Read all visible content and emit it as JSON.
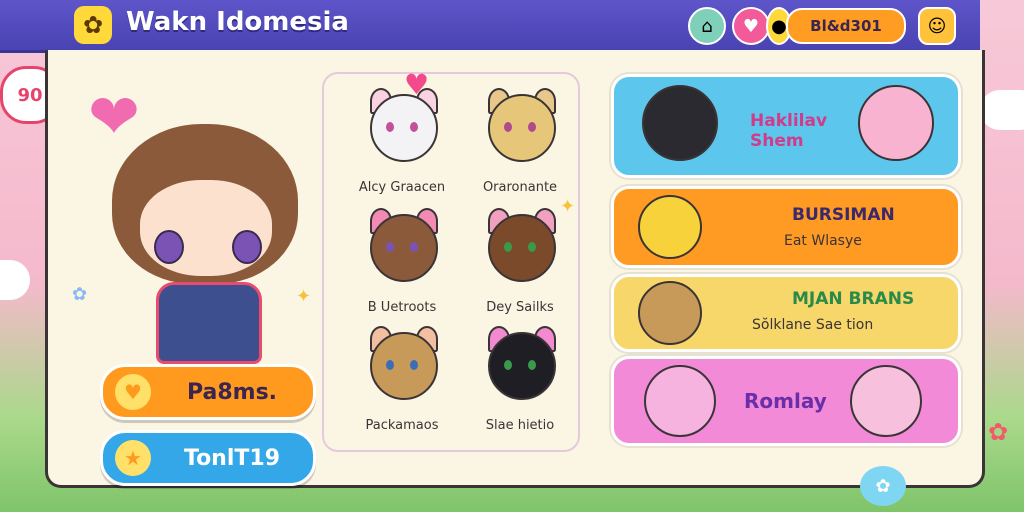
{
  "header": {
    "title": "Wakn Idomesia",
    "currency_value": "Bl&d301"
  },
  "left": {
    "badge_text": "90",
    "buttons": [
      {
        "label": "Pa8ms.",
        "color": "#ff9a1f",
        "icon": "heart-icon"
      },
      {
        "label": "TonlT19",
        "color": "#33a7e8",
        "icon": "star-icon"
      }
    ]
  },
  "characters": [
    {
      "name": "Alcy Graacen"
    },
    {
      "name": "Oraronante"
    },
    {
      "name": "B Uetroots"
    },
    {
      "name": "Dey Sailks"
    },
    {
      "name": "Packamaos"
    },
    {
      "name": "Slae hietio"
    }
  ],
  "cards": [
    {
      "title": "Haklilav Shem",
      "subtitle": "",
      "color": "#5dc6ec",
      "text_color": "#2a5fb0"
    },
    {
      "title": "BURSIMAN",
      "subtitle": "Eat Wlasye",
      "color": "#ff9a22",
      "text_color": "#3a2a6b"
    },
    {
      "title": "MJAN BRANS",
      "subtitle": "Sŏlklane Sae tion",
      "color": "#f7d76a",
      "text_color": "#2a8a4a"
    },
    {
      "title": "Romlay",
      "subtitle": "",
      "color": "#f28ad8",
      "text_color": "#6a2fa8"
    }
  ]
}
